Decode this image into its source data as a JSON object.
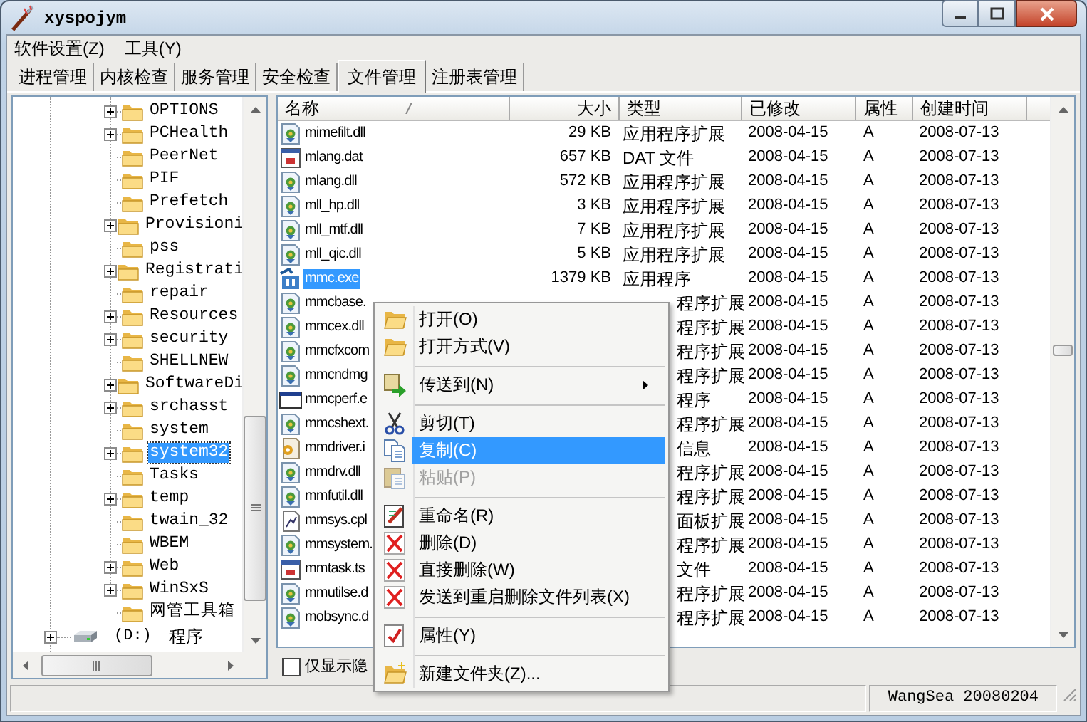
{
  "window": {
    "title": "xyspojym"
  },
  "menu_bar": [
    "软件设置(Z)",
    "工具(Y)"
  ],
  "tabs": [
    {
      "label": "进程管理",
      "selected": false
    },
    {
      "label": "内核检查",
      "selected": false
    },
    {
      "label": "服务管理",
      "selected": false
    },
    {
      "label": "安全检查",
      "selected": false
    },
    {
      "label": "文件管理",
      "selected": true
    },
    {
      "label": "注册表管理",
      "selected": false
    }
  ],
  "tree": {
    "folders": [
      {
        "label": "OPTIONS",
        "expandable": true,
        "selected": false
      },
      {
        "label": "PCHealth",
        "expandable": true,
        "selected": false
      },
      {
        "label": "PeerNet",
        "expandable": false,
        "selected": false
      },
      {
        "label": "PIF",
        "expandable": false,
        "selected": false
      },
      {
        "label": "Prefetch",
        "expandable": false,
        "selected": false
      },
      {
        "label": "Provisioni",
        "expandable": true,
        "selected": false
      },
      {
        "label": "pss",
        "expandable": false,
        "selected": false
      },
      {
        "label": "Registrati",
        "expandable": true,
        "selected": false
      },
      {
        "label": "repair",
        "expandable": false,
        "selected": false
      },
      {
        "label": "Resources",
        "expandable": true,
        "selected": false
      },
      {
        "label": "security",
        "expandable": true,
        "selected": false
      },
      {
        "label": "SHELLNEW",
        "expandable": false,
        "selected": false
      },
      {
        "label": "SoftwareDi",
        "expandable": true,
        "selected": false
      },
      {
        "label": "srchasst",
        "expandable": true,
        "selected": false
      },
      {
        "label": "system",
        "expandable": false,
        "selected": false
      },
      {
        "label": "system32",
        "expandable": true,
        "selected": true
      },
      {
        "label": "Tasks",
        "expandable": false,
        "selected": false
      },
      {
        "label": "temp",
        "expandable": true,
        "selected": false
      },
      {
        "label": "twain_32",
        "expandable": false,
        "selected": false
      },
      {
        "label": "WBEM",
        "expandable": false,
        "selected": false
      },
      {
        "label": "Web",
        "expandable": true,
        "selected": false
      },
      {
        "label": "WinSxS",
        "expandable": true,
        "selected": false
      },
      {
        "label": "网管工具箱",
        "expandable": false,
        "selected": false
      }
    ],
    "drives": [
      {
        "letter": "(D:)",
        "label": "程序",
        "expandable": true
      }
    ]
  },
  "file_list": {
    "columns": [
      "名称",
      "大小",
      "类型",
      "已修改",
      "属性",
      "创建时间"
    ],
    "rows": [
      {
        "name": "mimefilt.dll",
        "size": "29 KB",
        "type": "应用程序扩展",
        "modified": "2008-04-15",
        "attributes": "A",
        "created": "2008-07-13",
        "selected": false
      },
      {
        "name": "mlang.dat",
        "size": "657 KB",
        "type": "DAT 文件",
        "modified": "2008-04-15",
        "attributes": "A",
        "created": "2008-07-13",
        "selected": false
      },
      {
        "name": "mlang.dll",
        "size": "572 KB",
        "type": "应用程序扩展",
        "modified": "2008-04-15",
        "attributes": "A",
        "created": "2008-07-13",
        "selected": false
      },
      {
        "name": "mll_hp.dll",
        "size": "3 KB",
        "type": "应用程序扩展",
        "modified": "2008-04-15",
        "attributes": "A",
        "created": "2008-07-13",
        "selected": false
      },
      {
        "name": "mll_mtf.dll",
        "size": "7 KB",
        "type": "应用程序扩展",
        "modified": "2008-04-15",
        "attributes": "A",
        "created": "2008-07-13",
        "selected": false
      },
      {
        "name": "mll_qic.dll",
        "size": "5 KB",
        "type": "应用程序扩展",
        "modified": "2008-04-15",
        "attributes": "A",
        "created": "2008-07-13",
        "selected": false
      },
      {
        "name": "mmc.exe",
        "size": "1379 KB",
        "type": "应用程序",
        "modified": "2008-04-15",
        "attributes": "A",
        "created": "2008-07-13",
        "selected": true
      },
      {
        "name": "mmcbase.",
        "type": "程序扩展",
        "modified": "2008-04-15",
        "attributes": "A",
        "created": "2008-07-13",
        "selected": false
      },
      {
        "name": "mmcex.dll",
        "type": "程序扩展",
        "modified": "2008-04-15",
        "attributes": "A",
        "created": "2008-07-13",
        "selected": false
      },
      {
        "name": "mmcfxcom",
        "type": "程序扩展",
        "modified": "2008-04-15",
        "attributes": "A",
        "created": "2008-07-13",
        "selected": false
      },
      {
        "name": "mmcndmg",
        "type": "程序扩展",
        "modified": "2008-04-15",
        "attributes": "A",
        "created": "2008-07-13",
        "selected": false
      },
      {
        "name": "mmcperf.e",
        "type": "程序",
        "modified": "2008-04-15",
        "attributes": "A",
        "created": "2008-07-13",
        "selected": false
      },
      {
        "name": "mmcshext.",
        "type": "程序扩展",
        "modified": "2008-04-15",
        "attributes": "A",
        "created": "2008-07-13",
        "selected": false
      },
      {
        "name": "mmdriver.i",
        "type": "信息",
        "modified": "2008-04-15",
        "attributes": "A",
        "created": "2008-07-13",
        "selected": false
      },
      {
        "name": "mmdrv.dll",
        "type": "程序扩展",
        "modified": "2008-04-15",
        "attributes": "A",
        "created": "2008-07-13",
        "selected": false
      },
      {
        "name": "mmfutil.dll",
        "type": "程序扩展",
        "modified": "2008-04-15",
        "attributes": "A",
        "created": "2008-07-13",
        "selected": false
      },
      {
        "name": "mmsys.cpl",
        "type": "面板扩展",
        "modified": "2008-04-15",
        "attributes": "A",
        "created": "2008-07-13",
        "selected": false
      },
      {
        "name": "mmsystem.",
        "type": "程序扩展",
        "modified": "2008-04-15",
        "attributes": "A",
        "created": "2008-07-13",
        "selected": false
      },
      {
        "name": "mmtask.ts",
        "type": "文件",
        "modified": "2008-04-15",
        "attributes": "A",
        "created": "2008-07-13",
        "selected": false
      },
      {
        "name": "mmutilse.d",
        "type": "程序扩展",
        "modified": "2008-04-15",
        "attributes": "A",
        "created": "2008-07-13",
        "selected": false
      },
      {
        "name": "mobsync.d",
        "type": "程序扩展",
        "modified": "2008-04-15",
        "attributes": "A",
        "created": "2008-07-13",
        "selected": false
      }
    ]
  },
  "hidden_only_checkbox": {
    "label": "仅显示隐",
    "checked": false
  },
  "context_menu": [
    {
      "kind": "item",
      "label": "打开(O)",
      "selected": false,
      "disabled": false
    },
    {
      "kind": "item",
      "label": "打开方式(V)",
      "selected": false,
      "disabled": false
    },
    {
      "kind": "separator"
    },
    {
      "kind": "submenu",
      "label": "传送到(N)",
      "selected": false,
      "disabled": false
    },
    {
      "kind": "separator"
    },
    {
      "kind": "item",
      "label": "剪切(T)",
      "selected": false,
      "disabled": false
    },
    {
      "kind": "item",
      "label": "复制(C)",
      "selected": true,
      "disabled": false
    },
    {
      "kind": "item",
      "label": "粘贴(P)",
      "selected": false,
      "disabled": true
    },
    {
      "kind": "separator"
    },
    {
      "kind": "item",
      "label": "重命名(R)",
      "selected": false,
      "disabled": false
    },
    {
      "kind": "item",
      "label": "删除(D)",
      "selected": false,
      "disabled": false
    },
    {
      "kind": "item",
      "label": "直接删除(W)",
      "selected": false,
      "disabled": false
    },
    {
      "kind": "item",
      "label": "发送到重启删除文件列表(X)",
      "selected": false,
      "disabled": false
    },
    {
      "kind": "separator"
    },
    {
      "kind": "item",
      "label": "属性(Y)",
      "selected": false,
      "disabled": false
    },
    {
      "kind": "separator"
    },
    {
      "kind": "item",
      "label": "新建文件夹(Z)...",
      "selected": false,
      "disabled": false
    }
  ],
  "status_bar": [
    "WangSea 20080204"
  ]
}
